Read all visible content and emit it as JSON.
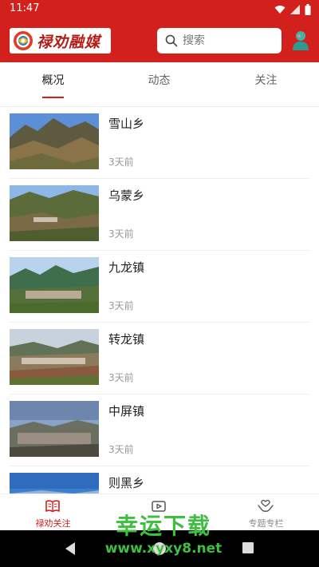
{
  "status_bar": {
    "time": "11:47"
  },
  "header": {
    "logo_text": "禄劝融媒",
    "search_placeholder": "搜索"
  },
  "tabs": [
    {
      "label": "概况",
      "active": true
    },
    {
      "label": "动态",
      "active": false
    },
    {
      "label": "关注",
      "active": false
    }
  ],
  "list": [
    {
      "title": "雪山乡",
      "time": "3天前"
    },
    {
      "title": "乌蒙乡",
      "time": "3天前"
    },
    {
      "title": "九龙镇",
      "time": "3天前"
    },
    {
      "title": "转龙镇",
      "time": "3天前"
    },
    {
      "title": "中屏镇",
      "time": "3天前"
    },
    {
      "title": "则黑乡",
      "time": ""
    }
  ],
  "bottom_nav": [
    {
      "label": "禄劝关注",
      "icon": "book-icon",
      "active": true
    },
    {
      "label": "",
      "icon": "video-icon",
      "active": false
    },
    {
      "label": "专题专栏",
      "icon": "hands-icon",
      "active": false
    }
  ],
  "watermark": {
    "text": "幸运下载",
    "url": "www.xyxy8.net"
  },
  "colors": {
    "brand_red": "#d2211c",
    "watermark_green": "#3fbf3f"
  }
}
